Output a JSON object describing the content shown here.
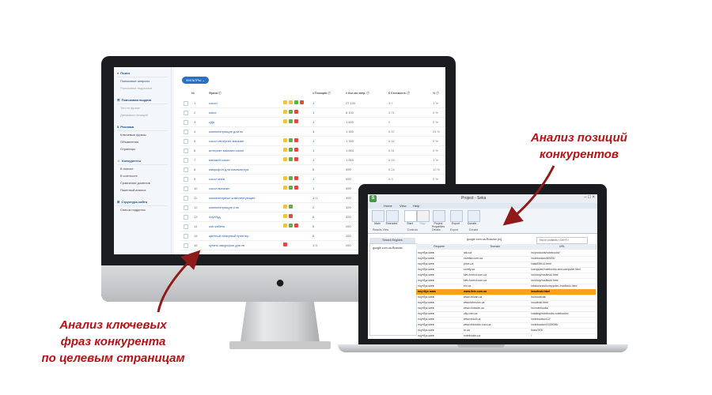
{
  "imac_app": {
    "sidebar": {
      "sections": [
        {
          "label": "Поиск",
          "icon": "search-icon",
          "items": [
            {
              "label": "Поисковые запросы",
              "state": "active"
            },
            {
              "label": "Поисковые подсказки",
              "state": "disabled"
            }
          ]
        },
        {
          "label": "Поисковая выдача",
          "icon": "list-icon",
          "items": [
            {
              "label": "Топ по фразе",
              "state": "disabled"
            },
            {
              "label": "Динамика позиций",
              "state": "disabled"
            }
          ]
        },
        {
          "label": "Реклама",
          "icon": "dollar-icon",
          "items": [
            {
              "label": "Ключевые фразы",
              "state": "normal"
            },
            {
              "label": "Объявления",
              "state": "normal"
            },
            {
              "label": "Страницы",
              "state": "normal"
            }
          ]
        },
        {
          "label": "Конкуренты",
          "icon": "users-icon",
          "items": [
            {
              "label": "В поиске",
              "state": "normal"
            },
            {
              "label": "В контексте",
              "state": "normal"
            },
            {
              "label": "Сравнение доменов",
              "state": "normal"
            },
            {
              "label": "Пакетный анализ",
              "state": "normal"
            }
          ]
        },
        {
          "label": "Структура сайта",
          "icon": "sitemap-icon",
          "items": [
            {
              "label": "Список подделок",
              "state": "normal"
            }
          ]
        }
      ]
    },
    "filter_button": "ФИЛЬТРЫ ⌄",
    "table": {
      "headers": [
        "№",
        "Фраза ⓘ",
        "# Позиция ⓘ",
        "# Кол-во запр. ⓘ",
        "$ Стоимость ⓘ",
        "% ⓘ"
      ],
      "rows": [
        {
          "num": "1",
          "phrase": "сокол",
          "badges": [
            "#f3c13a",
            "#f3c13a",
            "#61b146",
            "#e24b3b"
          ],
          "pos": "1",
          "freq": "27 100",
          "cost": "3.7",
          "pct": "1 %"
        },
        {
          "num": "2",
          "phrase": "sokol",
          "badges": [
            "#f3c13a",
            "#61b146",
            "#e24b3b"
          ],
          "pos": "1",
          "freq": "8 100",
          "cost": "0.71",
          "pct": "0 %"
        },
        {
          "num": "3",
          "phrase": "cjrjk",
          "badges": [
            "#f3c13a",
            "#61b146",
            "#e24b3b"
          ],
          "pos": "1",
          "freq": "1 600",
          "cost": "0",
          "pct": "0 %"
        },
        {
          "num": "4",
          "phrase": "комплектующие для пк",
          "badges": [],
          "pos": "3",
          "freq": "1 300",
          "cost": "0.37",
          "pct": "24 %"
        },
        {
          "num": "5",
          "phrase": "сокол интернет магазин",
          "badges": [
            "#f3c13a",
            "#61b146",
            "#e24b3b"
          ],
          "pos": "1",
          "freq": "1 300",
          "cost": "0.02",
          "pct": "5 %"
        },
        {
          "num": "6",
          "phrase": "интернет магазин сокол",
          "badges": [
            "#f3c13a",
            "#61b146",
            "#e24b3b"
          ],
          "pos": "1",
          "freq": "1 000",
          "cost": "0.31",
          "pct": "0 %"
        },
        {
          "num": "7",
          "phrase": "магазин сокол",
          "badges": [
            "#f3c13a",
            "#61b146",
            "#e24b3b"
          ],
          "pos": "1",
          "freq": "1 000",
          "cost": "0.03",
          "pct": "1 %"
        },
        {
          "num": "8",
          "phrase": "микрофон для компьютера",
          "badges": [],
          "pos": "5",
          "freq": "590",
          "cost": "0.24",
          "pct": "10 %"
        },
        {
          "num": "9",
          "phrase": "сокол киев",
          "badges": [
            "#f3c13a",
            "#61b146",
            "#e24b3b"
          ],
          "pos": "1",
          "freq": "590",
          "cost": "0.3",
          "pct": "0 %"
        },
        {
          "num": "10",
          "phrase": "сокол магазин",
          "badges": [
            "#f3c13a",
            "#61b146",
            "#e24b3b"
          ],
          "pos": "1",
          "freq": "590",
          "cost": "0.01",
          "pct": "0 %"
        },
        {
          "num": "11",
          "phrase": "компьютерные комплектующие",
          "badges": [],
          "pos": "1↑1",
          "freq": "390",
          "cost": "0.15",
          "pct": "2 %"
        },
        {
          "num": "12",
          "phrase": "комплектующие к пк",
          "badges": [
            "#f3c13a",
            "#61b146"
          ],
          "pos": "2",
          "freq": "320",
          "cost": "0.41",
          "pct": "2 %"
        },
        {
          "num": "13",
          "phrase": "ноутбуд",
          "badges": [
            "#f3c13a",
            "#e24b3b"
          ],
          "pos": "5",
          "freq": "320",
          "cost": "0.29",
          "pct": "3 %"
        },
        {
          "num": "14",
          "phrase": "usb кабель",
          "badges": [
            "#f3c13a",
            "#61b146",
            "#e24b3b"
          ],
          "pos": "5",
          "freq": "260",
          "cost": "0.18",
          "pct": "0 %"
        },
        {
          "num": "15",
          "phrase": "цветной лазерный принтер",
          "badges": [],
          "pos": "5",
          "freq": "260",
          "cost": "0.24",
          "pct": "1 %"
        },
        {
          "num": "16",
          "phrase": "купить микрофон для пк",
          "badges": [
            "#e24b3b"
          ],
          "pos": "1↑1",
          "freq": "260",
          "cost": "0.12",
          "pct": "0 %"
        }
      ]
    }
  },
  "laptop_app": {
    "title": "Project - Seka",
    "tabs": [
      "Home",
      "View",
      "Help"
    ],
    "ribbon_buttons": [
      "Main",
      "Extended",
      "Start",
      "Stop",
      "Project Properties",
      "Export",
      "Donate..."
    ],
    "ribbon_groups": [
      "Results View",
      "Controls",
      "Details",
      "Export",
      "Donate"
    ],
    "search_engines_label": "Search Engines",
    "tree_item": "google.com.ua-Russian",
    "right_panel_title": "google.com.ua-Russian [ru]",
    "find_placeholder": "find in contents <Ctrl+F>",
    "grid_headers": [
      "Request",
      "Domain",
      "URL"
    ],
    "grid_rows": [
      {
        "request": "ноутбук киев",
        "domain": "allo.ua",
        "url": "/ru/products/notebooks/",
        "highlight": false
      },
      {
        "request": "ноутбук киев",
        "domain": "rozetka.com.ua",
        "url": "/notebooks/c80004/",
        "highlight": false
      },
      {
        "request": "ноутбук киев",
        "domain": "price.ua",
        "url": "/catc839t14.html",
        "highlight": false
      },
      {
        "request": "ноутбук киев",
        "domain": "comfy.ua",
        "url": "/computer/notebooks-and-computer.html",
        "highlight": false
      },
      {
        "request": "ноутбук киев",
        "domain": "kiev.foxtrot.com.ua",
        "url": "/ru/shop/noutbuki.html",
        "highlight": false
      },
      {
        "request": "ноутбук киев",
        "domain": "kiev.foxtrot.com.ua",
        "url": "/ru/shop/noutbuki.html",
        "highlight": false
      },
      {
        "request": "ноутбук киев",
        "domain": "elc.ua",
        "url": "/ekstorands/kompyuter-/noutbuki.html",
        "highlight": false
      },
      {
        "request": "ноутбук киев",
        "domain": "www.5elc.com.ua",
        "url": "/noutbuki.html",
        "highlight": true
      },
      {
        "request": "ноутбук киев",
        "domain": "www.zhivan.ua",
        "url": "/ru/noutbuki/",
        "highlight": false
      },
      {
        "request": "ноутбук киев",
        "domain": "www.tehnolux.ua",
        "url": "/noutbuki.html",
        "highlight": false
      },
      {
        "request": "ноутбук киев",
        "domain": "www.xlotrade.ua",
        "url": "/ru/notebooks/",
        "highlight": false
      },
      {
        "request": "ноутбук киев",
        "domain": "city.com.ua",
        "url": "/catalog/notebooks-notebooks/",
        "highlight": false
      },
      {
        "request": "ноутбук киев",
        "domain": "www.eldoll.ua",
        "url": "/notebooks/c12/",
        "highlight": false
      },
      {
        "request": "ноутбук киев",
        "domain": "www.eldorado.com.ua",
        "url": "/notebooks/c1039096/",
        "highlight": false
      },
      {
        "request": "ноутбук киев",
        "domain": "m.ua",
        "url": "/katc/293/",
        "highlight": false
      },
      {
        "request": "ноутбук киев",
        "domain": "notebooks.ua",
        "url": "/",
        "highlight": false
      }
    ]
  },
  "annotations": {
    "left": [
      "Анализ ключевых",
      "фраз конкурента",
      "по целевым страницам"
    ],
    "right": [
      "Анализ позиций",
      "конкурентов"
    ]
  },
  "colors": {
    "annotation": "#b31217",
    "link": "#1f5fb4",
    "highlight_row": "#f7a11e",
    "filter_button": "#2a6fc9"
  }
}
